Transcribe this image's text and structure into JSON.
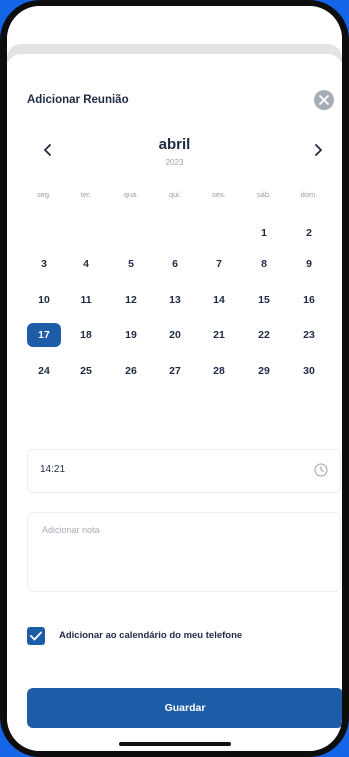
{
  "modal": {
    "title": "Adicionar Reunião",
    "close_icon": "close-icon"
  },
  "calendar": {
    "month": "abril",
    "year": "2023",
    "prev_icon": "chevron-left-icon",
    "next_icon": "chevron-right-icon",
    "weekdays": [
      "seg.",
      "ter.",
      "qua.",
      "qui.",
      "sex.",
      "sáb.",
      "dom."
    ],
    "weeks": [
      [
        "",
        "",
        "",
        "",
        "",
        "1",
        "2"
      ],
      [
        "3",
        "4",
        "5",
        "6",
        "7",
        "8",
        "9"
      ],
      [
        "10",
        "11",
        "12",
        "13",
        "14",
        "15",
        "16"
      ],
      [
        "17",
        "18",
        "19",
        "20",
        "21",
        "22",
        "23"
      ],
      [
        "24",
        "25",
        "26",
        "27",
        "28",
        "29",
        "30"
      ]
    ],
    "selected_day": "17"
  },
  "time": {
    "value": "14:21",
    "icon": "clock-icon"
  },
  "note": {
    "placeholder": "Adicionar nota"
  },
  "phone_calendar": {
    "checked": true,
    "label": "Adicionar ao calendário do meu telefone"
  },
  "save_button": {
    "label": "Guardar"
  },
  "colors": {
    "primary": "#1d5da8",
    "background": "#1565e8",
    "text": "#1f2a44",
    "muted": "#9aa1ab"
  }
}
